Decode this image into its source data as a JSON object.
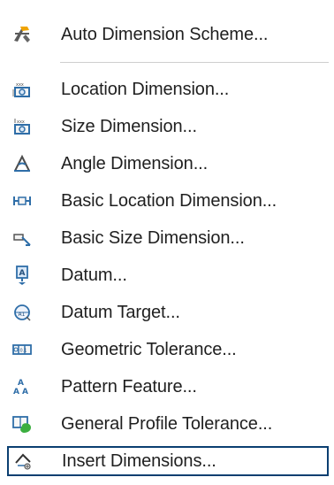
{
  "menu": {
    "items": [
      {
        "label": "Auto Dimension Scheme...",
        "icon": "auto-dimension-scheme-icon"
      },
      {
        "label": "Location Dimension...",
        "icon": "location-dimension-icon"
      },
      {
        "label": "Size Dimension...",
        "icon": "size-dimension-icon"
      },
      {
        "label": "Angle Dimension...",
        "icon": "angle-dimension-icon"
      },
      {
        "label": "Basic Location Dimension...",
        "icon": "basic-location-dimension-icon"
      },
      {
        "label": "Basic Size Dimension...",
        "icon": "basic-size-dimension-icon"
      },
      {
        "label": "Datum...",
        "icon": "datum-icon"
      },
      {
        "label": "Datum Target...",
        "icon": "datum-target-icon"
      },
      {
        "label": "Geometric Tolerance...",
        "icon": "geometric-tolerance-icon"
      },
      {
        "label": "Pattern Feature...",
        "icon": "pattern-feature-icon"
      },
      {
        "label": "General Profile Tolerance...",
        "icon": "general-profile-tolerance-icon"
      },
      {
        "label": "Insert Dimensions...",
        "icon": "insert-dimensions-icon",
        "highlighted": true
      }
    ]
  }
}
